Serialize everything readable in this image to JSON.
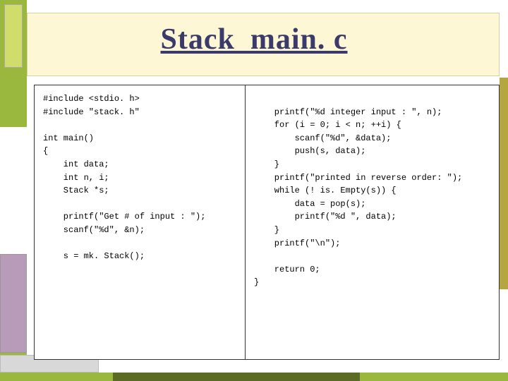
{
  "title": "Stack_main. c",
  "code_left": "#include <stdio. h>\n#include \"stack. h\"\n\nint main()\n{\n    int data;\n    int n, i;\n    Stack *s;\n\n    printf(\"Get # of input : \");\n    scanf(\"%d\", &n);\n\n    s = mk. Stack();",
  "code_right": "\n    printf(\"%d integer input : \", n);\n    for (i = 0; i < n; ++i) {\n        scanf(\"%d\", &data);\n        push(s, data);\n    }\n    printf(\"printed in reverse order: \");\n    while (! is. Empty(s)) {\n        data = pop(s);\n        printf(\"%d \", data);\n    }\n    printf(\"\\n\");\n\n    return 0;\n}"
}
